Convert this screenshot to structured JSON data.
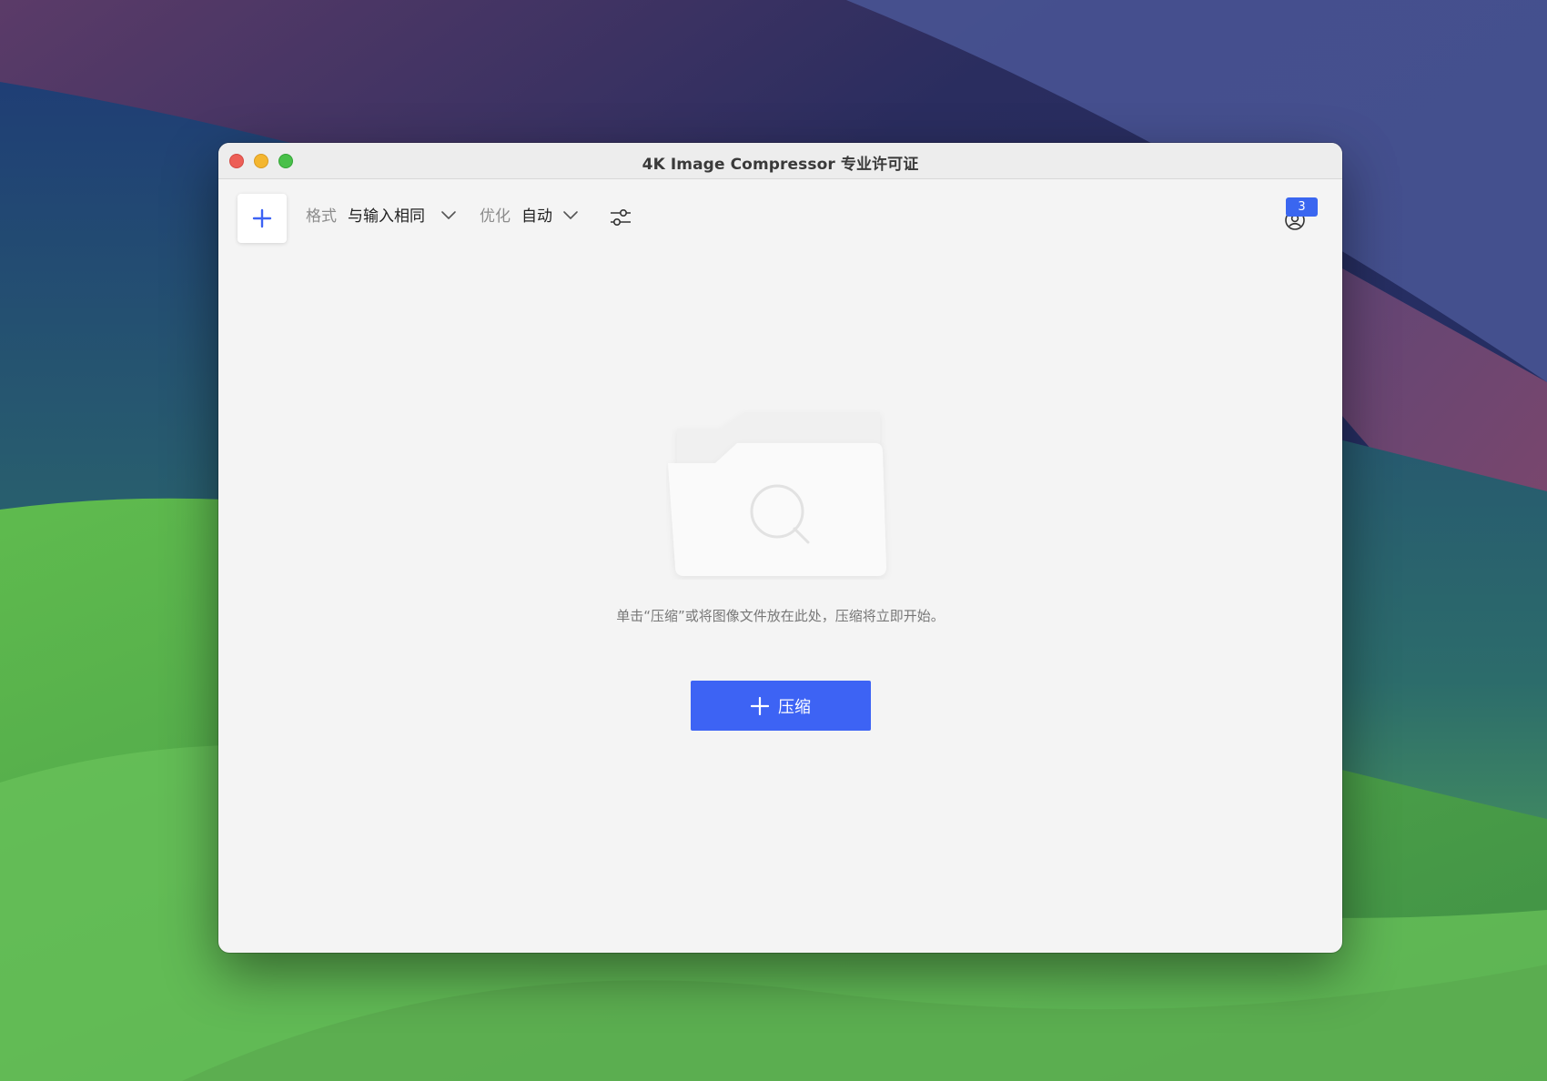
{
  "window": {
    "title": "4K Image Compressor 专业许可证"
  },
  "toolbar": {
    "add_icon": "plus-icon",
    "format_label": "格式",
    "format_value": "与输入相同",
    "optimize_label": "优化",
    "optimize_value": "自动",
    "settings_icon": "sliders-icon",
    "account_icon": "user-icon",
    "notification_count": "3"
  },
  "main": {
    "illustration_icon": "folder-search-icon",
    "hint": "单击“压缩”或将图像文件放在此处，压缩将立即开始。",
    "compress_button_label": "压缩",
    "compress_button_icon": "plus-icon"
  },
  "colors": {
    "accent": "#3d63f4",
    "badge": "#3a66f0",
    "window_bg": "#f4f4f4"
  }
}
